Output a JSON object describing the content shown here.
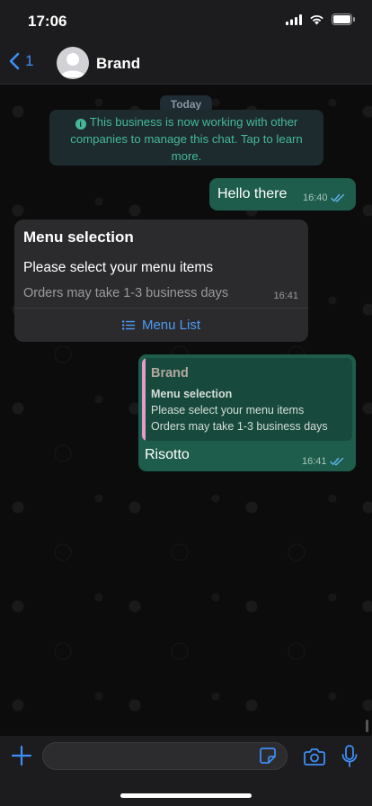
{
  "status_bar": {
    "time": "17:06"
  },
  "nav": {
    "back_count": "1",
    "contact_name": "Brand"
  },
  "chat": {
    "date_label": "Today",
    "system_notice": "This business is now working with other companies to manage this chat. Tap to learn more.",
    "messages": [
      {
        "direction": "out",
        "text": "Hello there",
        "time": "16:40",
        "status": "read"
      },
      {
        "direction": "in",
        "title": "Menu selection",
        "body": "Please select your menu items",
        "footer": "Orders may take 1-3 business days",
        "time": "16:41",
        "button_label": "Menu List"
      },
      {
        "direction": "out",
        "quoted": {
          "sender": "Brand",
          "title": "Menu selection",
          "body": "Please select your menu items",
          "footer": "Orders may take 1-3 business days"
        },
        "text": "Risotto",
        "time": "16:41",
        "status": "read"
      }
    ]
  },
  "input": {
    "placeholder": "",
    "value": ""
  },
  "icons": {
    "back": "chevron-left-icon",
    "plus": "plus-icon",
    "sticker": "sticker-icon",
    "camera": "camera-icon",
    "mic": "microphone-icon",
    "menu_list": "list-icon",
    "info": "info-icon",
    "read_receipt": "double-check-icon"
  },
  "colors": {
    "accent": "#3e8ef7",
    "outgoing_bubble": "#1e5d4b",
    "incoming_bubble": "#2b2b2e",
    "system_text": "#46b89a",
    "quote_bar": "#e79bc8"
  }
}
